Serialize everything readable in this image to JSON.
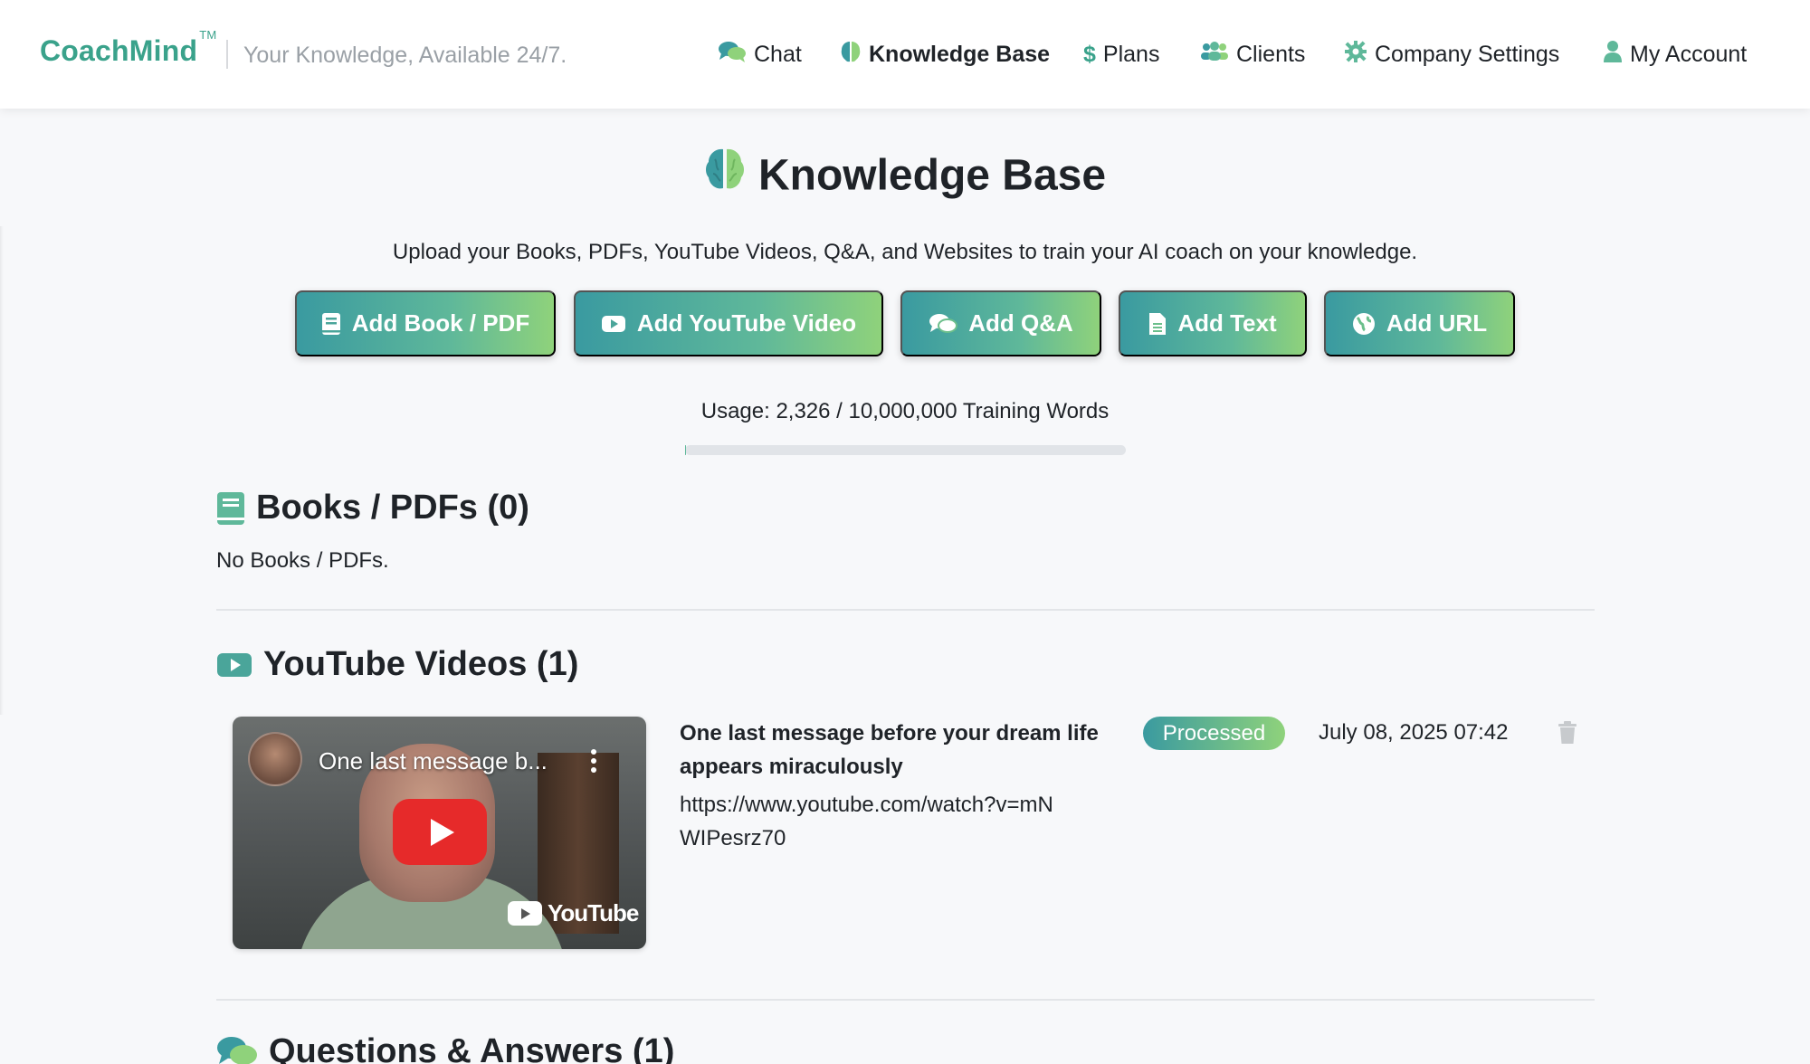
{
  "header": {
    "brand": "CoachMind",
    "brand_tm": "TM",
    "tagline": "Your Knowledge, Available 24/7.",
    "nav": [
      {
        "label": "Chat",
        "icon": "chat-icon",
        "active": false
      },
      {
        "label": "Knowledge Base",
        "icon": "brain-icon",
        "active": true
      },
      {
        "label": "Plans",
        "icon": "dollar-icon",
        "active": false
      },
      {
        "label": "Clients",
        "icon": "users-icon",
        "active": false
      },
      {
        "label": "Company Settings",
        "icon": "gear-icon",
        "active": false
      },
      {
        "label": "My Account",
        "icon": "user-icon",
        "active": false
      }
    ]
  },
  "page": {
    "title": "Knowledge Base",
    "subtitle": "Upload your Books, PDFs, YouTube Videos, Q&A, and Websites to train your AI coach on your knowledge."
  },
  "actions": [
    {
      "label": "Add Book / PDF",
      "icon": "book-icon"
    },
    {
      "label": "Add YouTube Video",
      "icon": "youtube-icon"
    },
    {
      "label": "Add Q&A",
      "icon": "comments-icon"
    },
    {
      "label": "Add Text",
      "icon": "file-text-icon"
    },
    {
      "label": "Add URL",
      "icon": "globe-icon"
    }
  ],
  "usage": {
    "text": "Usage: 2,326 / 10,000,000 Training Words",
    "used": 2326,
    "limit": 10000000
  },
  "sections": {
    "books": {
      "title": "Books / PDFs (0)",
      "empty_text": "No Books / PDFs."
    },
    "youtube": {
      "title": "YouTube Videos (1)",
      "videos": [
        {
          "thumbnail_title": "One last message b...",
          "thumbnail_logo": "YouTube",
          "title": "One last message before your dream life appears miraculously",
          "url": "https://www.youtube.com/watch?v=mNWIPesrz70",
          "status": "Processed",
          "date": "July 08, 2025 07:42"
        }
      ]
    },
    "qa": {
      "title": "Questions & Answers (1)"
    }
  },
  "colors": {
    "accent": "#3aa28b",
    "gradient_start": "#3a9aa0",
    "gradient_end": "#8fd27b",
    "background": "#f7f8fa"
  }
}
